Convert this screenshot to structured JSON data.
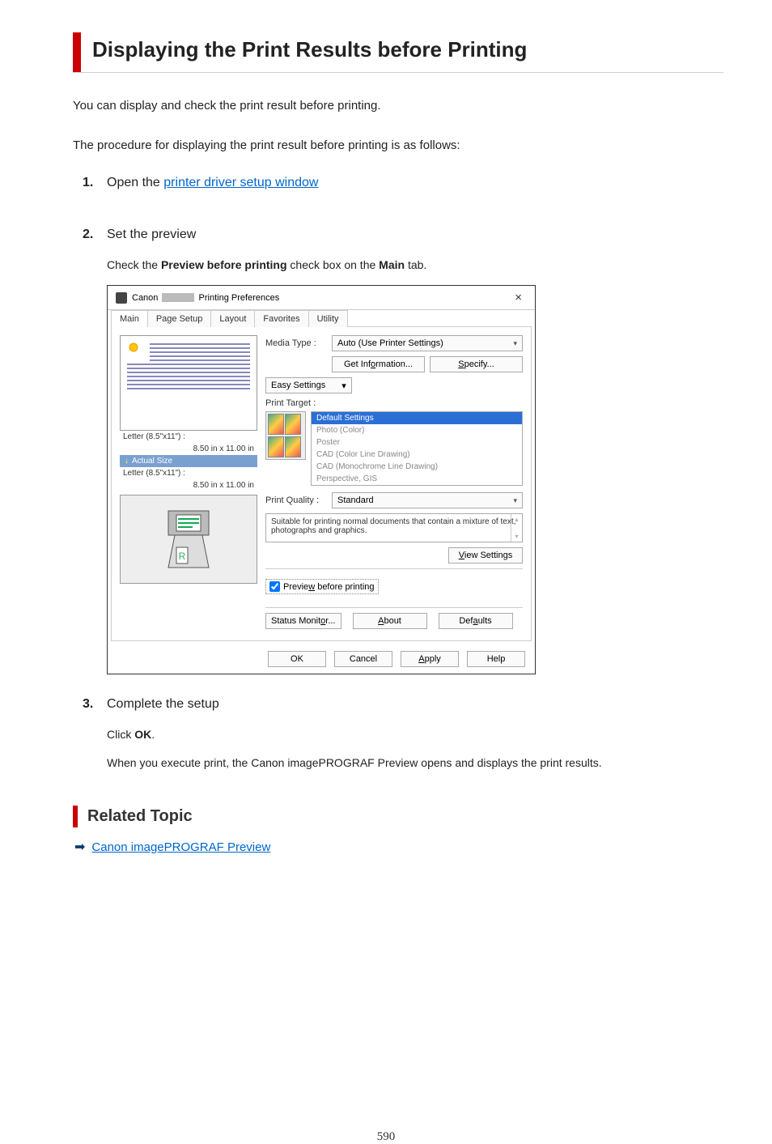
{
  "title": "Displaying the Print Results before Printing",
  "intro1": "You can display and check the print result before printing.",
  "intro2": "The procedure for displaying the print result before printing is as follows:",
  "steps": [
    {
      "num": "1.",
      "title_pre": "Open the ",
      "title_link": "printer driver setup window"
    },
    {
      "num": "2.",
      "title": "Set the preview",
      "check_text_1": "Check the ",
      "check_bold_1": "Preview before printing",
      "check_text_2": " check box on the ",
      "check_bold_2": "Main",
      "check_text_3": " tab."
    },
    {
      "num": "3.",
      "title": "Complete the setup",
      "text_1a": "Click ",
      "text_1b": "OK",
      "text_1c": ".",
      "text_2": "When you execute print, the Canon imagePROGRAF Preview opens and displays the print results."
    }
  ],
  "dialog": {
    "title_canon": "Canon",
    "title_suffix": "Printing Preferences",
    "tabs": [
      "Main",
      "Page Setup",
      "Layout",
      "Favorites",
      "Utility"
    ],
    "media_type_label": "Media Type :",
    "media_type_value": "Auto (Use Printer Settings)",
    "get_info_btn_pre": "Get Inf",
    "get_info_btn_u": "o",
    "get_info_btn_post": "rmation...",
    "specify_btn_u": "S",
    "specify_btn_post": "pecify...",
    "easy_settings": "Easy Settings",
    "print_target_label": "Print Target :",
    "targets": [
      "Default Settings",
      "Photo (Color)",
      "Poster",
      "CAD (Color Line Drawing)",
      "CAD (Monochrome Line Drawing)",
      "Perspective, GIS"
    ],
    "letter1": "Letter (8.5\"x11\") :",
    "size1": "8.50 in x 11.00 in",
    "actual_size": "Actual Size",
    "letter2": "Letter (8.5\"x11\") :",
    "size2": "8.50 in x 11.00 in",
    "print_quality_label": "Print Quality :",
    "print_quality_value": "Standard",
    "description": "Suitable for printing normal documents that contain a mixture of text, photographs and graphics.",
    "view_settings_u": "V",
    "view_settings_post": "iew Settings",
    "preview_cb_pre": "Previe",
    "preview_cb_u": "w",
    "preview_cb_post": " before printing",
    "status_pre": "Status Monit",
    "status_u": "o",
    "status_post": "r...",
    "about_u": "A",
    "about_post": "bout",
    "defaults_pre": "Def",
    "defaults_u": "a",
    "defaults_post": "ults",
    "ok": "OK",
    "cancel": "Cancel",
    "apply_u": "A",
    "apply_post": "pply",
    "help": "Help"
  },
  "related": {
    "heading": "Related Topic",
    "link": "Canon imagePROGRAF Preview"
  },
  "page_number": "590"
}
